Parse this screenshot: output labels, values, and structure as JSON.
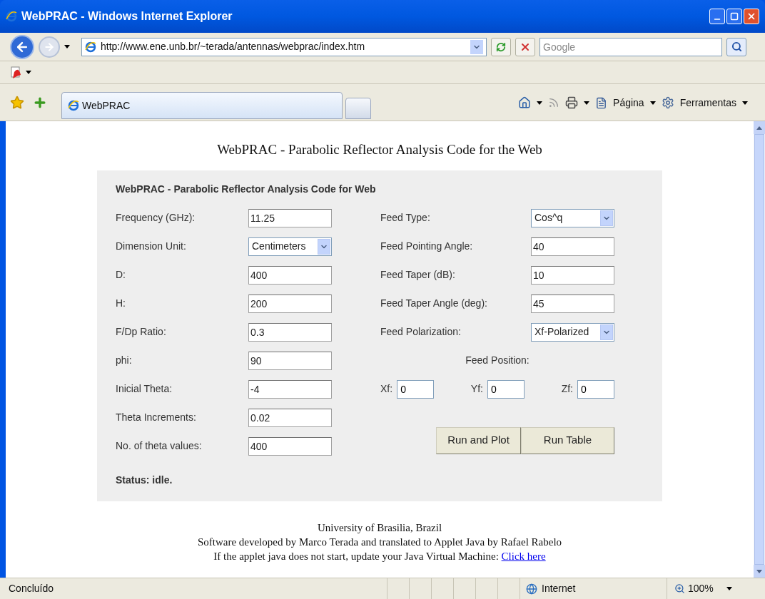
{
  "window": {
    "title": "WebPRAC - Windows Internet Explorer"
  },
  "address_bar": {
    "url": "http://www.ene.unb.br/~terada/antennas/webprac/index.htm",
    "search_placeholder": "Google"
  },
  "tabs": [
    {
      "label": "WebPRAC",
      "selected": true
    }
  ],
  "command_bar": [
    "Página",
    "Ferramentas"
  ],
  "page": {
    "heading": "WebPRAC - Parabolic Reflector Analysis Code for the Web",
    "applet": {
      "title": "WebPRAC - Parabolic Reflector Analysis Code for Web",
      "left_fields": [
        {
          "label": "Frequency (GHz):",
          "value": "11.25",
          "kind": "text"
        },
        {
          "label": "Dimension Unit:",
          "value": "Centimeters",
          "kind": "select"
        },
        {
          "label": "D:",
          "value": "400",
          "kind": "text"
        },
        {
          "label": "H:",
          "value": "200",
          "kind": "text"
        },
        {
          "label": "F/Dp Ratio:",
          "value": "0.3",
          "kind": "text"
        },
        {
          "label": "phi:",
          "value": "90",
          "kind": "text"
        },
        {
          "label": "Inicial Theta:",
          "value": "-4",
          "kind": "text"
        },
        {
          "label": "Theta Increments:",
          "value": "0.02",
          "kind": "text"
        },
        {
          "label": "No. of theta values:",
          "value": "400",
          "kind": "text"
        }
      ],
      "right_fields": [
        {
          "label": "Feed Type:",
          "value": "Cos^q",
          "kind": "select"
        },
        {
          "label": "Feed Pointing Angle:",
          "value": "40",
          "kind": "text"
        },
        {
          "label": "Feed Taper (dB):",
          "value": "10",
          "kind": "text"
        },
        {
          "label": "Feed Taper Angle (deg):",
          "value": "45",
          "kind": "text"
        },
        {
          "label": "Feed Polarization:",
          "value": "Xf-Polarized",
          "kind": "select"
        }
      ],
      "feed_position": {
        "label": "Feed Position:",
        "fields": [
          {
            "label": "Xf:",
            "value": "0"
          },
          {
            "label": "Yf:",
            "value": "0"
          },
          {
            "label": "Zf:",
            "value": "0"
          }
        ]
      },
      "buttons": [
        "Run and Plot",
        "Run Table"
      ],
      "status": "Status: idle."
    },
    "footer": {
      "lines": [
        "University of Brasilia, Brazil",
        "Software developed by Marco Terada and translated to Applet Java by Rafael Rabelo",
        "If the applet java does not start, update your Java Virtual Machine:"
      ],
      "link": "Click here"
    }
  },
  "status_bar": {
    "text": "Concluído",
    "zone": "Internet",
    "zoom": "100%"
  }
}
